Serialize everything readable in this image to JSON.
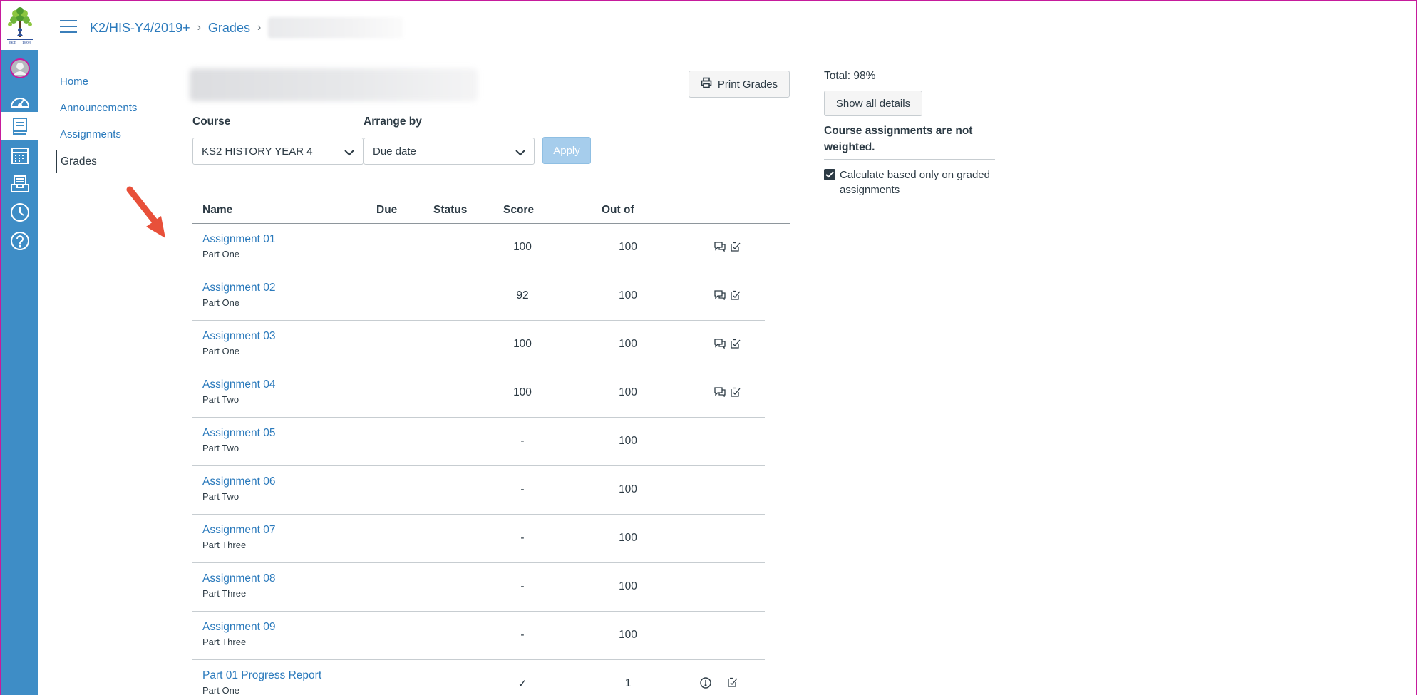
{
  "breadcrumb": {
    "course": "K2/HIS-Y4/2019+",
    "section": "Grades"
  },
  "course_nav": [
    {
      "label": "Home"
    },
    {
      "label": "Announcements"
    },
    {
      "label": "Assignments"
    },
    {
      "label": "Grades"
    }
  ],
  "global_nav_icons": [
    "account-icon",
    "dashboard-icon",
    "courses-icon",
    "calendar-icon",
    "inbox-icon",
    "history-icon",
    "help-icon"
  ],
  "toolbar": {
    "print_label": "Print Grades"
  },
  "filters": {
    "course_label": "Course",
    "course_value": "KS2 HISTORY YEAR 4",
    "arrange_label": "Arrange by",
    "arrange_value": "Due date",
    "apply_label": "Apply"
  },
  "table": {
    "headers": [
      "Name",
      "Due",
      "Status",
      "Score",
      "Out of"
    ],
    "rows": [
      {
        "name": "Assignment 01",
        "group": "Part One",
        "score": "100",
        "out_of": "100"
      },
      {
        "name": "Assignment 02",
        "group": "Part One",
        "score": "92",
        "out_of": "100"
      },
      {
        "name": "Assignment 03",
        "group": "Part One",
        "score": "100",
        "out_of": "100"
      },
      {
        "name": "Assignment 04",
        "group": "Part Two",
        "score": "100",
        "out_of": "100"
      },
      {
        "name": "Assignment 05",
        "group": "Part Two",
        "score": "-",
        "out_of": "100"
      },
      {
        "name": "Assignment 06",
        "group": "Part Two",
        "score": "-",
        "out_of": "100"
      },
      {
        "name": "Assignment 07",
        "group": "Part Three",
        "score": "-",
        "out_of": "100"
      },
      {
        "name": "Assignment 08",
        "group": "Part Three",
        "score": "-",
        "out_of": "100"
      },
      {
        "name": "Assignment 09",
        "group": "Part Three",
        "score": "-",
        "out_of": "100"
      },
      {
        "name": "Part 01 Progress Report",
        "group": "Part One",
        "score": "✓",
        "out_of": "1"
      }
    ]
  },
  "sidebar": {
    "total": "Total: 98%",
    "show_details_label": "Show all details",
    "weight_note": "Course assignments are not weighted.",
    "calc_label": "Calculate based only on graded assignments"
  },
  "colors": {
    "global_nav": "#3e8dc6",
    "link": "#2b7abc",
    "apply_disabled": "#a6cdec",
    "annotation_arrow": "#e8503a"
  }
}
